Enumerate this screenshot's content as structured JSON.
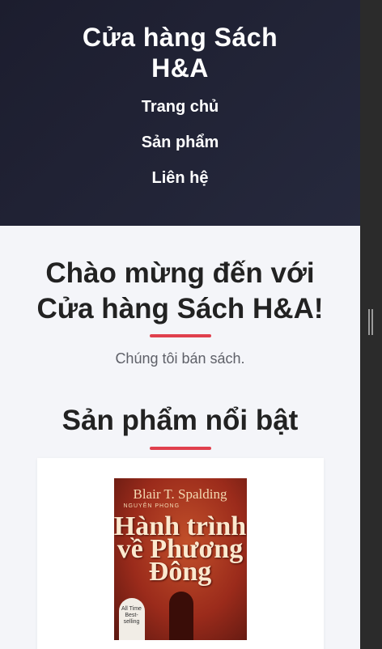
{
  "header": {
    "title": "Cửa hàng Sách H&A",
    "nav": [
      "Trang chủ",
      "Sản phẩm",
      "Liên hệ"
    ]
  },
  "hero": {
    "heading": "Chào mừng đến với Cửa hàng Sách H&A!",
    "tagline": "Chúng tôi bán sách."
  },
  "featured": {
    "heading": "Sản phẩm nổi bật",
    "products": [
      {
        "cover_author": "Blair T. Spalding",
        "cover_translator": "NGUYÊN PHONG",
        "cover_title": "Hành trình về Phương Đông",
        "cover_badge": "All Time Best-selling"
      }
    ]
  },
  "colors": {
    "header_bg": "#1c1d2e",
    "page_bg": "#f4f5f9",
    "accent": "#e0404d"
  }
}
